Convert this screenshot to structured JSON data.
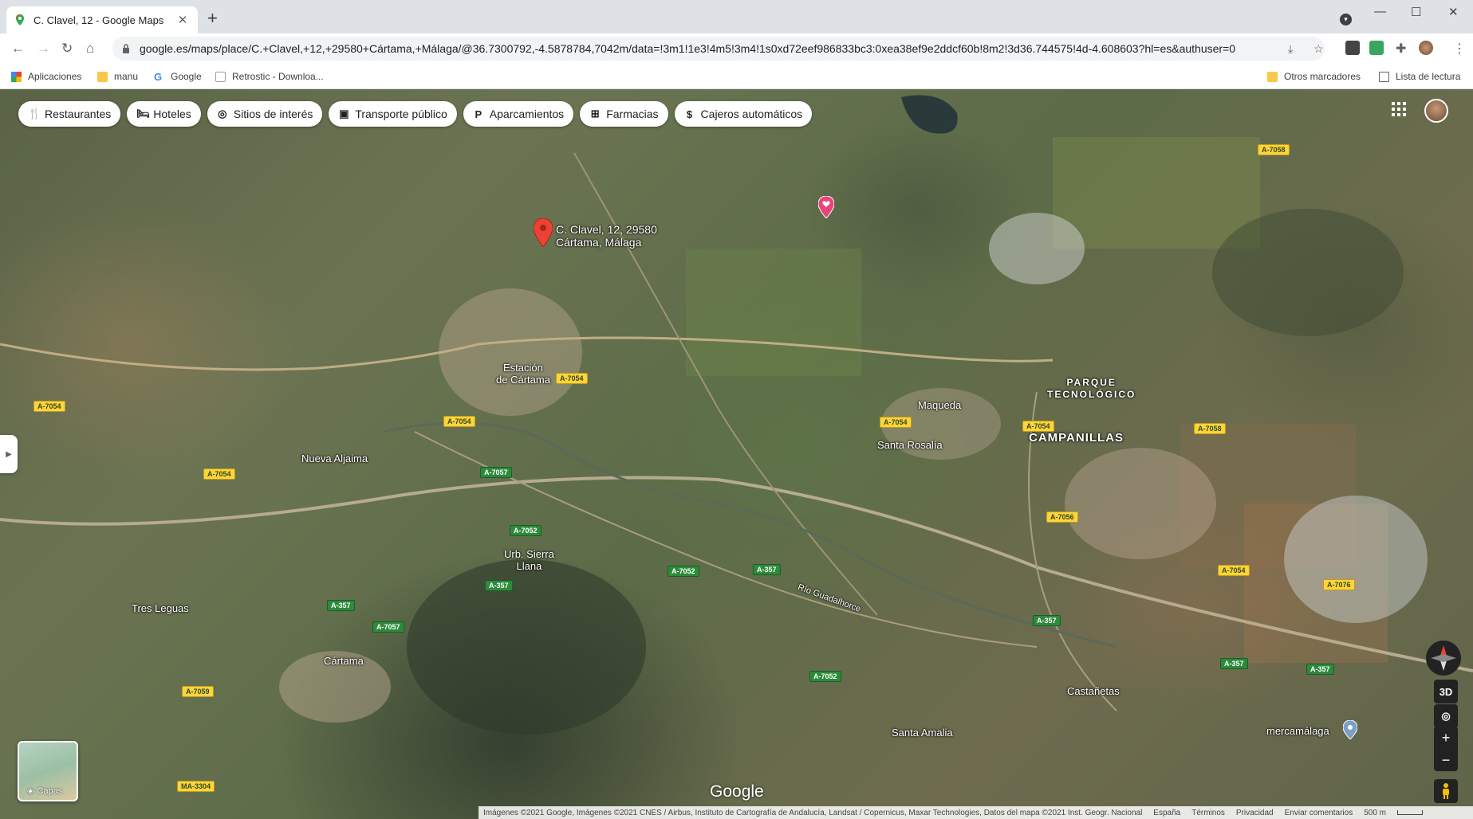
{
  "browser": {
    "tab_title": "C. Clavel, 12 - Google Maps",
    "url": "google.es/maps/place/C.+Clavel,+12,+29580+Cártama,+Málaga/@36.7300792,-4.5878784,7042m/data=!3m1!1e3!4m5!3m4!1s0xd72eef986833bc3:0xea38ef9e2ddcf60b!8m2!3d36.744575!4d-4.608603?hl=es&authuser=0",
    "bookmarks": [
      "Aplicaciones",
      "manu",
      "Google",
      "Retrostic - Downloa..."
    ],
    "bookmarks_right": [
      "Otros marcadores",
      "Lista de lectura"
    ]
  },
  "map": {
    "categories": [
      {
        "label": "Restaurantes",
        "icon": "restaurant-icon",
        "glyph": "🍴"
      },
      {
        "label": "Hoteles",
        "icon": "hotel-icon",
        "glyph": "🛏"
      },
      {
        "label": "Sitios de interés",
        "icon": "camera-icon",
        "glyph": "◎"
      },
      {
        "label": "Transporte público",
        "icon": "train-icon",
        "glyph": "▣"
      },
      {
        "label": "Aparcamientos",
        "icon": "parking-icon",
        "glyph": "P"
      },
      {
        "label": "Farmacias",
        "icon": "pharmacy-icon",
        "glyph": "⊞"
      },
      {
        "label": "Cajeros automáticos",
        "icon": "atm-icon",
        "glyph": "$"
      }
    ],
    "pin_address_line1": "C. Clavel, 12, 29580",
    "pin_address_line2": "Cártama, Málaga",
    "places": {
      "estacion_1": "Estación",
      "estacion_2": "de Cártama",
      "nueva_aljaima": "Nueva Aljaima",
      "urb_1": "Urb. Sierra",
      "urb_2": "Llana",
      "tres_leguas": "Tres Leguas",
      "cartama": "Cártama",
      "maqueda": "Maqueda",
      "santa_rosalia": "Santa Rosalía",
      "parque_1": "PARQUE",
      "parque_2": "TECNOLÓGICO",
      "campanillas": "CAMPANILLAS",
      "castanetas": "Castañetas",
      "santa_amalia": "Santa Amalia",
      "mercamalaga": "mercamálaga",
      "rio": "Río Guadalhorce"
    },
    "roads": [
      "A-7054",
      "A-7054",
      "A-7054",
      "A-7054",
      "A-7054",
      "A-7054",
      "A-7054",
      "A-7057",
      "A-7057",
      "A-7052",
      "A-7052",
      "A-7052",
      "A-357",
      "A-357",
      "A-357",
      "A-357",
      "A-357",
      "A-357",
      "A-7059",
      "MA-3304",
      "A-7058",
      "A-7058",
      "A-7056",
      "A-7076"
    ],
    "layers_label": "Capas",
    "controls": {
      "three_d": "3D",
      "zoom_in": "+",
      "zoom_out": "−"
    },
    "logo": "Google",
    "attribution": "Imágenes ©2021 Google, Imágenes ©2021 CNES / Airbus, Instituto de Cartografía de Andalucía, Landsat / Copernicus, Maxar Technologies, Datos del mapa ©2021 Inst. Geogr. Nacional",
    "footer_links": [
      "España",
      "Términos",
      "Privacidad",
      "Enviar comentarios"
    ],
    "scale": "500 m"
  }
}
